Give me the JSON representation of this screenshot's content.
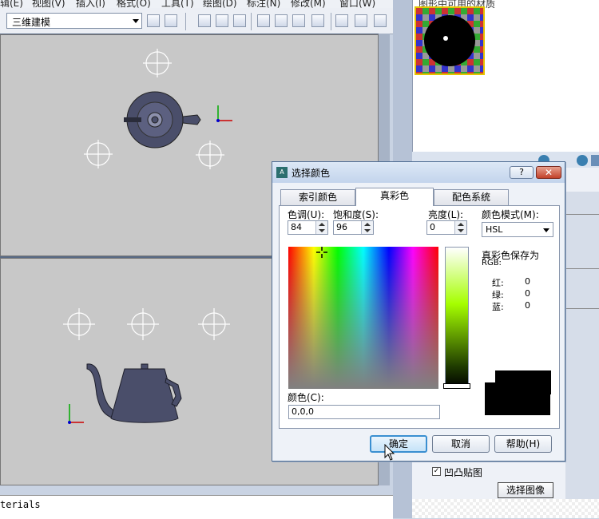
{
  "menu": {
    "items": [
      "辑(E)",
      "视图(V)",
      "插入(I)",
      "格式(O)",
      "工具(T)",
      "绘图(D)",
      "标注(N)",
      "修改(M)",
      "窗口(W)"
    ]
  },
  "toolbar": {
    "workspace": "三维建模"
  },
  "command": {
    "text": "terials"
  },
  "right_panel": {
    "title": "图形中可用的材质",
    "checkbox_label": "凹凸贴图",
    "checkbox_checked": true,
    "select_image_button": "选择图像"
  },
  "dialog": {
    "title": "选择颜色",
    "help": "?",
    "close": "✕",
    "tabs": [
      "索引颜色",
      "真彩色",
      "配色系统"
    ],
    "active_tab": 1,
    "hue_label": "色调(U):",
    "hue_value": "84",
    "saturation_label": "饱和度(S):",
    "saturation_value": "96",
    "luminance_label": "亮度(L):",
    "luminance_value": "0",
    "color_model_label": "颜色模式(M):",
    "color_model_value": "HSL",
    "stored_as_label": "真彩色保存为",
    "stored_as_sub": "RGB:",
    "rgb": [
      {
        "label": "红:",
        "value": "0"
      },
      {
        "label": "绿:",
        "value": "0"
      },
      {
        "label": "蓝:",
        "value": "0"
      }
    ],
    "color_label": "颜色(C):",
    "color_value": "0,0,0",
    "ok": "确定",
    "cancel": "取消",
    "help_button": "帮助(H)"
  },
  "colors": {
    "viewport_bg": "#c8c8c8",
    "teapot": "#4a4e6a",
    "dialog_active_button": "#3a8fd1"
  }
}
